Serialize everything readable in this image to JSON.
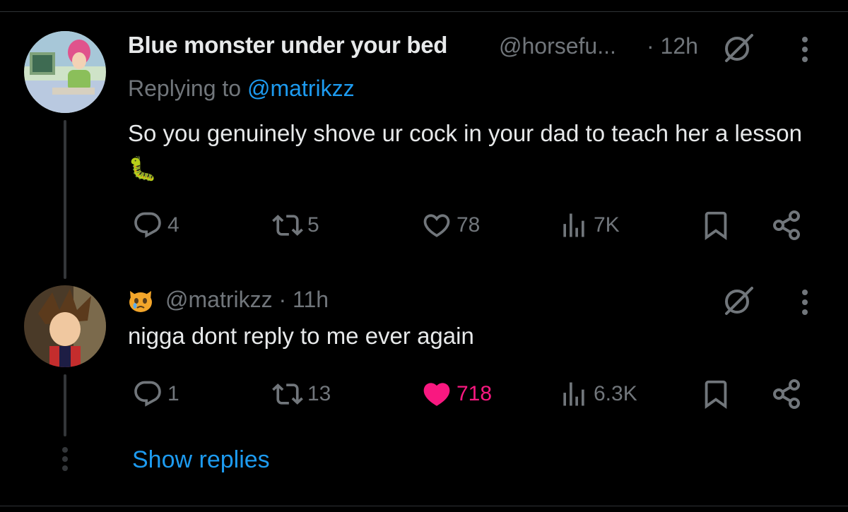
{
  "tweet1": {
    "display_name": "Blue monster under your bed",
    "handle": "@horsefu...",
    "time": "· 12h",
    "replying_prefix": "Replying to",
    "replying_to": "@matrikzz",
    "text": "So you genuinely shove ur cock in your dad to teach her a lesson 🐛",
    "replies": "4",
    "reposts": "5",
    "likes": "78",
    "views": "7K"
  },
  "tweet2": {
    "handle_time": "@matrikzz · 11h",
    "text": "nigga dont reply to me ever again",
    "replies": "1",
    "reposts": "13",
    "likes": "718",
    "views": "6.3K"
  },
  "show_replies": "Show replies",
  "colors": {
    "background": "#000000",
    "text": "#e7e9ea",
    "muted": "#71767b",
    "link": "#1d9bf0",
    "like": "#f91880"
  },
  "icons": [
    "grok-icon",
    "more-icon",
    "reply-icon",
    "repost-icon",
    "like-icon",
    "views-icon",
    "bookmark-icon",
    "share-icon"
  ]
}
